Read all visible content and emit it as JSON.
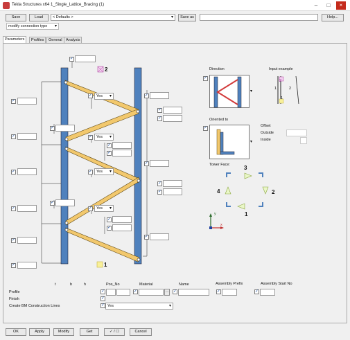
{
  "window": {
    "title": "Tekla Structures x64  1_Single_Lattice_Bracing (1)"
  },
  "toolbar": {
    "save": "Save",
    "load": "Load",
    "preset": "< Defaults >",
    "save_as": "Save as",
    "save_as_value": "",
    "help": "Help..."
  },
  "modify_type": "modify connection type",
  "tabs": [
    "Parameters",
    "Profiles",
    "General",
    "Analysis"
  ],
  "drawing": {
    "label_top": "2",
    "label_bottom": "1"
  },
  "combo_yes": [
    "Yes",
    "Yes",
    "Yes",
    "Yes"
  ],
  "direction": {
    "label": "Direction"
  },
  "input_example": {
    "label": "Input example",
    "n2": "2",
    "n1": "1",
    "n1b": "1",
    "n2b": "2"
  },
  "oriented": {
    "label": "Oriented to",
    "offset": "Offset",
    "outside": "Outside",
    "inside": "Inside"
  },
  "tower_face": {
    "label": "Tower Face:",
    "n3": "3",
    "n4": "4",
    "n2": "2",
    "n1": "1"
  },
  "axes": {
    "y": "y",
    "x": "x"
  },
  "bottom": {
    "col_t": "t",
    "col_b": "b",
    "col_h": "h",
    "pos_no": "Pos_No",
    "material": "Material",
    "name": "Name",
    "assembly_prefix": "Assembly Prefix",
    "assembly_start": "Assembly Start No",
    "profile": "Profile",
    "finish": "Finish",
    "create_bm": "Create BM Construction Lines",
    "bm_value": "Yes",
    "material_btn": "..."
  },
  "footer": {
    "ok": "OK",
    "apply": "Apply",
    "modify": "Modify",
    "get": "Get",
    "toggle": "✓ / ☐",
    "cancel": "Cancel"
  },
  "colors": {
    "column": "#4f81bd",
    "brace": "#f2c86d",
    "active_tab": "#ffffff"
  }
}
